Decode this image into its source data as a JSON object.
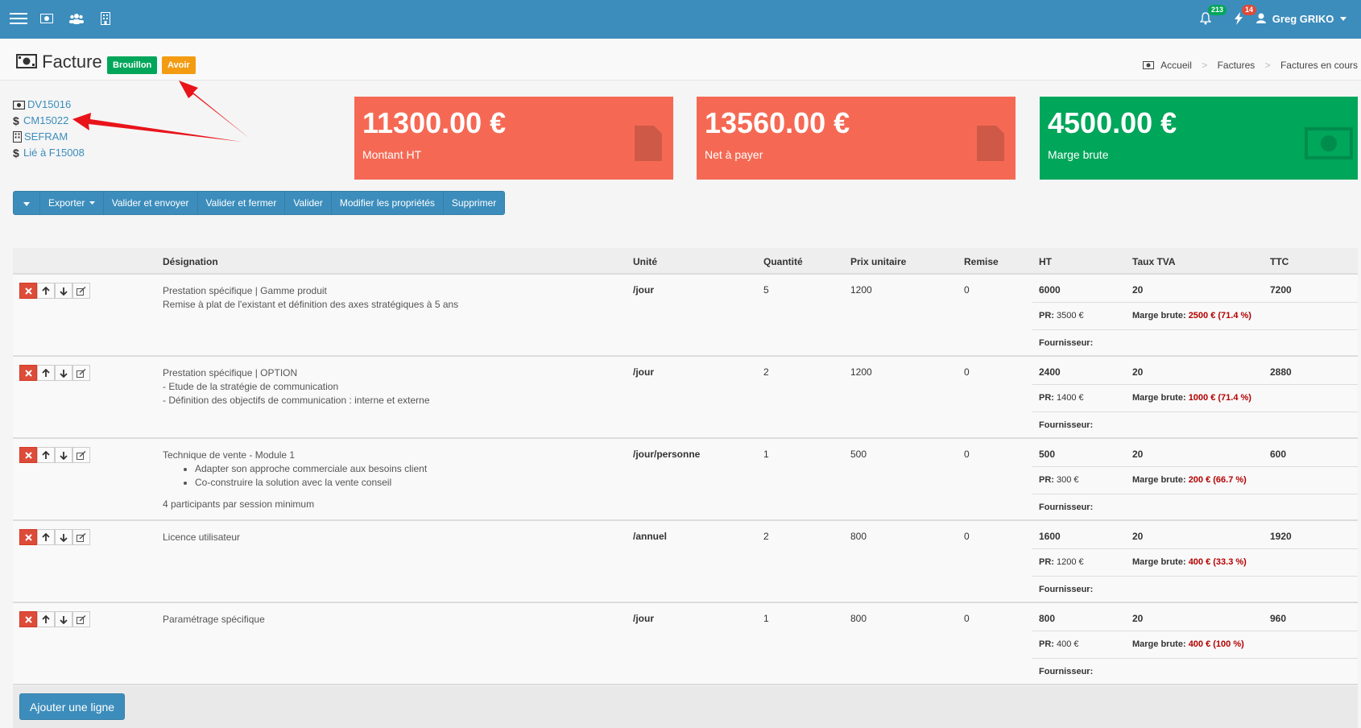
{
  "topbar": {
    "notifications_count": "213",
    "alerts_count": "14",
    "user_name": "Greg GRIKO",
    "colors": {
      "bar": "#3c8dbc",
      "badge_green": "#00a65a",
      "badge_red": "#dd4b39"
    }
  },
  "header": {
    "title": "Facture",
    "badge_draft": "Brouillon",
    "badge_credit": "Avoir",
    "breadcrumb": [
      "Accueil",
      "Factures",
      "Factures en cours"
    ]
  },
  "links": [
    {
      "icon": "money-icon",
      "text": "DV15016"
    },
    {
      "icon": "dollar-icon",
      "text": "CM15022"
    },
    {
      "icon": "building-icon",
      "text": "SEFRAM"
    },
    {
      "icon": "dollar-icon",
      "text": "Lié à F15008"
    }
  ],
  "kpis": [
    {
      "value": "11300.00 €",
      "label": "Montant HT",
      "color": "#f56954"
    },
    {
      "value": "13560.00 €",
      "label": "Net à payer",
      "color": "#f56954"
    },
    {
      "value": "4500.00 €",
      "label": "Marge brute",
      "color": "#00a65a"
    }
  ],
  "toolbar": {
    "export": "Exporter",
    "validate_send": "Valider et envoyer",
    "validate_close": "Valider et fermer",
    "validate": "Valider",
    "edit_props": "Modifier les propriétés",
    "delete": "Supprimer"
  },
  "table": {
    "headers": {
      "designation": "Désignation",
      "unit": "Unité",
      "qty": "Quantité",
      "unit_price": "Prix unitaire",
      "discount": "Remise",
      "ht": "HT",
      "vat": "Taux TVA",
      "ttc": "TTC"
    },
    "labels": {
      "pr": "PR:",
      "margin": "Marge brute:",
      "supplier": "Fournisseur:"
    },
    "rows": [
      {
        "title": "Prestation spécifique | Gamme produit",
        "lines": [
          "Remise à plat de l'existant et définition des axes stratégiques à 5 ans"
        ],
        "unit": "/jour",
        "qty": "5",
        "price": "1200",
        "discount": "0",
        "ht": "6000",
        "vat": "20",
        "ttc": "7200",
        "pr": "3500 €",
        "margin": "2500 € (71.4 %)"
      },
      {
        "title": "Prestation spécifique | OPTION",
        "lines": [
          "- Etude de la stratégie de communication",
          "- Définition des objectifs de communication : interne et externe"
        ],
        "unit": "/jour",
        "qty": "2",
        "price": "1200",
        "discount": "0",
        "ht": "2400",
        "vat": "20",
        "ttc": "2880",
        "pr": "1400 €",
        "margin": "1000 € (71.4 %)"
      },
      {
        "title": "Technique de vente - Module 1",
        "bullets": [
          "Adapter son approche commerciale aux besoins client",
          "Co-construire la solution avec la vente conseil"
        ],
        "footer_line": "4 participants par session minimum",
        "unit": "/jour/personne",
        "qty": "1",
        "price": "500",
        "discount": "0",
        "ht": "500",
        "vat": "20",
        "ttc": "600",
        "pr": "300 €",
        "margin": "200 € (66.7 %)"
      },
      {
        "title": "Licence utilisateur",
        "unit": "/annuel",
        "qty": "2",
        "price": "800",
        "discount": "0",
        "ht": "1600",
        "vat": "20",
        "ttc": "1920",
        "pr": "1200 €",
        "margin": "400 € (33.3 %)"
      },
      {
        "title": "Paramétrage spécifique",
        "unit": "/jour",
        "qty": "1",
        "price": "800",
        "discount": "0",
        "ht": "800",
        "vat": "20",
        "ttc": "960",
        "pr": "400 €",
        "margin": "400 € (100 %)"
      }
    ]
  },
  "footer": {
    "add_line": "Ajouter une ligne"
  }
}
